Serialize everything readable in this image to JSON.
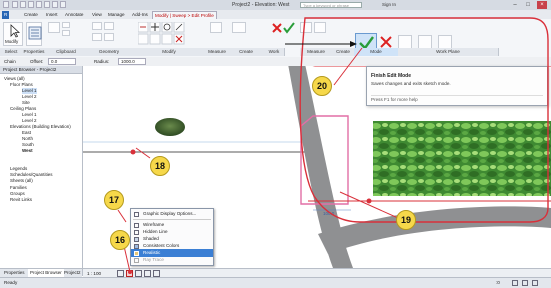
{
  "titlebar": {
    "title": "Project2 - Elevation: West",
    "search_placeholder": "Type a keyword or phrase",
    "sign_in": "Sign In"
  },
  "tabs": [
    {
      "label": "Create"
    },
    {
      "label": "Insert"
    },
    {
      "label": "Annotate"
    },
    {
      "label": "View"
    },
    {
      "label": "Manage"
    },
    {
      "label": "Add-Ins"
    },
    {
      "label": "Modify | Sweep > Edit Profile"
    }
  ],
  "ribbon": {
    "panels": [
      {
        "label": "Select"
      },
      {
        "label": "Properties"
      },
      {
        "label": "Clipboard"
      },
      {
        "label": "Geometry"
      },
      {
        "label": "Modify"
      },
      {
        "label": "Measure"
      },
      {
        "label": "Create"
      },
      {
        "label": "Work"
      },
      {
        "label": "Measure"
      },
      {
        "label": "Create"
      },
      {
        "label": "Mode"
      },
      {
        "label": "Work Plane"
      }
    ],
    "modify_label": "Modify"
  },
  "options_bar": {
    "chain_label": "Chain",
    "offset_label": "Offset:",
    "offset_value": "0.0",
    "radius_label": "Radius:",
    "radius_value": "1000.0"
  },
  "browser": {
    "header": "Project Browser - Project2",
    "items": [
      {
        "label": "Views (all)"
      },
      {
        "label": "Floor Plans"
      },
      {
        "label": "Level 1"
      },
      {
        "label": "Level 2"
      },
      {
        "label": "Site"
      },
      {
        "label": "Ceiling Plans"
      },
      {
        "label": "Level 1"
      },
      {
        "label": "Level 2"
      },
      {
        "label": "Elevations (Building Elevation)"
      },
      {
        "label": "East"
      },
      {
        "label": "North"
      },
      {
        "label": "South"
      },
      {
        "label": "West"
      },
      {
        "label": "Legends"
      },
      {
        "label": "Schedules/Quantities"
      },
      {
        "label": "Sheets (all)"
      },
      {
        "label": "Families"
      },
      {
        "label": "Groups"
      },
      {
        "label": "Revit Links"
      }
    ],
    "tabs": [
      "Properties",
      "Project Browser",
      "Project2"
    ]
  },
  "view_bar": {
    "scale": "1 : 100"
  },
  "context_menu": {
    "items": [
      {
        "label": "Graphic Display Options..."
      },
      {
        "label": "Wireframe"
      },
      {
        "label": "Hidden Line"
      },
      {
        "label": "Shaded"
      },
      {
        "label": "Consistent Colors"
      },
      {
        "label": "Realistic"
      },
      {
        "label": "Ray Trace"
      }
    ],
    "highlighted_index": 5
  },
  "tooltip": {
    "title": "Finish Edit Mode",
    "description": "Saves changes and exits sketch mode.",
    "help": "Press F1 for more help"
  },
  "canvas": {
    "dimension_label": "100.0"
  },
  "status": {
    "text": "Ready",
    "zoom": ":0"
  },
  "callouts": [
    {
      "number": "16"
    },
    {
      "number": "17"
    },
    {
      "number": "18"
    },
    {
      "number": "19"
    },
    {
      "number": "20"
    }
  ],
  "colors": {
    "accent_red": "#d9303a",
    "callout_yellow": "#f6d84a",
    "finish_check_green": "#2a9d3a",
    "cancel_red": "#d22"
  }
}
